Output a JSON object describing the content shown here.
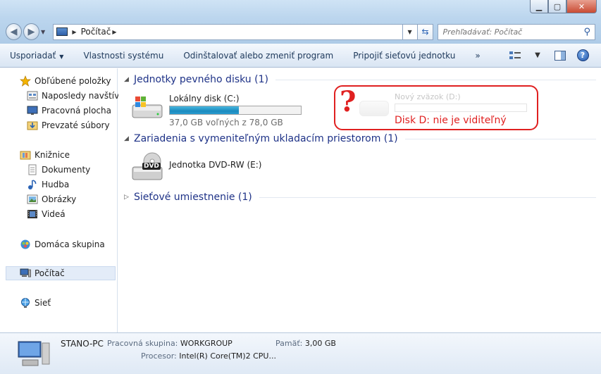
{
  "address_bar": {
    "crumb": "Počítač"
  },
  "search": {
    "placeholder": "Prehľadávať: Počítač"
  },
  "command_bar": {
    "organize": "Usporiadať",
    "system_properties": "Vlastnosti systému",
    "uninstall": "Odinštalovať alebo zmeniť program",
    "map_drive": "Pripojiť sieťovú jednotku",
    "more": "»"
  },
  "sidebar": {
    "favorites": {
      "label": "Obľúbené položky",
      "items": [
        "Naposledy navštíver",
        "Pracovná plocha",
        "Prevzaté súbory"
      ]
    },
    "libraries": {
      "label": "Knižnice",
      "items": [
        "Dokumenty",
        "Hudba",
        "Obrázky",
        "Videá"
      ]
    },
    "homegroup": "Domáca skupina",
    "computer": "Počítač",
    "network": "Sieť"
  },
  "groups": {
    "hdd": {
      "header": "Jednotky pevného disku (1)",
      "drive": {
        "name": "Lokálny disk (C:)",
        "free": "37,0 GB voľných z 78,0 GB",
        "used_fraction": 0.526
      }
    },
    "removable": {
      "header": "Zariadenia s vymeniteľným ukladacím priestorom (1)",
      "drive": {
        "name": "Jednotka DVD-RW (E:)",
        "badge": "DVD"
      }
    },
    "network": {
      "header": "Sieťové umiestnenie (1)"
    }
  },
  "annotation": {
    "mark": "?",
    "ghost_drive": "Nový zväzok (D:)",
    "text": "Disk D: nie je viditeľný"
  },
  "details": {
    "name": "STANO-PC",
    "workgroup_label": "Pracovná skupina:",
    "workgroup_value": "WORKGROUP",
    "memory_label": "Pamäť:",
    "memory_value": "3,00 GB",
    "cpu_label": "Procesor:",
    "cpu_value": "Intel(R) Core(TM)2 CPU..."
  },
  "colors": {
    "accent": "#1e3287",
    "annotation": "#e02020",
    "bar_fill": "#1b8bbf"
  }
}
